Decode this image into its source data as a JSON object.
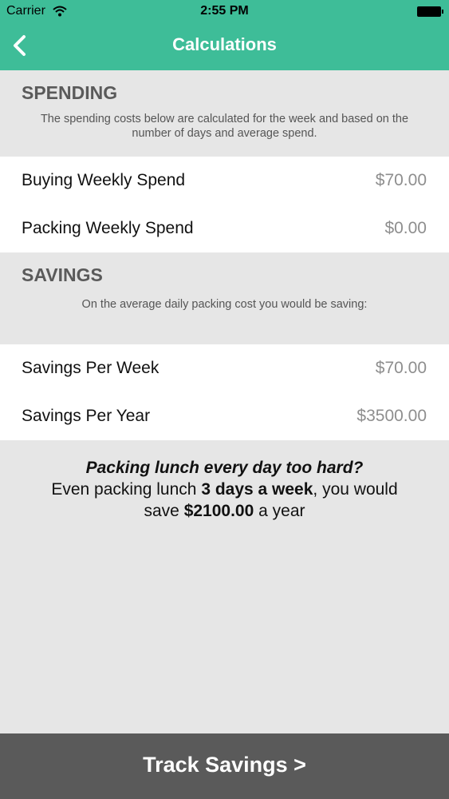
{
  "status_bar": {
    "carrier": "Carrier",
    "time": "2:55 PM"
  },
  "nav": {
    "title": "Calculations"
  },
  "spending": {
    "title": "SPENDING",
    "description": "The spending costs below are calculated for the week and based on the number of days and average spend.",
    "rows": [
      {
        "label": "Buying Weekly Spend",
        "value": "$70.00"
      },
      {
        "label": "Packing Weekly Spend",
        "value": "$0.00"
      }
    ]
  },
  "savings": {
    "title": "SAVINGS",
    "description": "On the average daily packing cost you would be saving:",
    "rows": [
      {
        "label": "Savings Per Week",
        "value": "$70.00"
      },
      {
        "label": "Savings Per Year",
        "value": "$3500.00"
      }
    ]
  },
  "promo": {
    "question": "Packing lunch every day too hard?",
    "line_prefix": "Even packing lunch ",
    "days": "3 days a week",
    "line_mid": ", you would save ",
    "amount": "$2100.00",
    "line_suffix": " a year"
  },
  "footer": {
    "button_label": "Track Savings >"
  },
  "colors": {
    "header": "#3ebd98",
    "background": "#e6e6e6",
    "footer": "#5a5a5a"
  }
}
